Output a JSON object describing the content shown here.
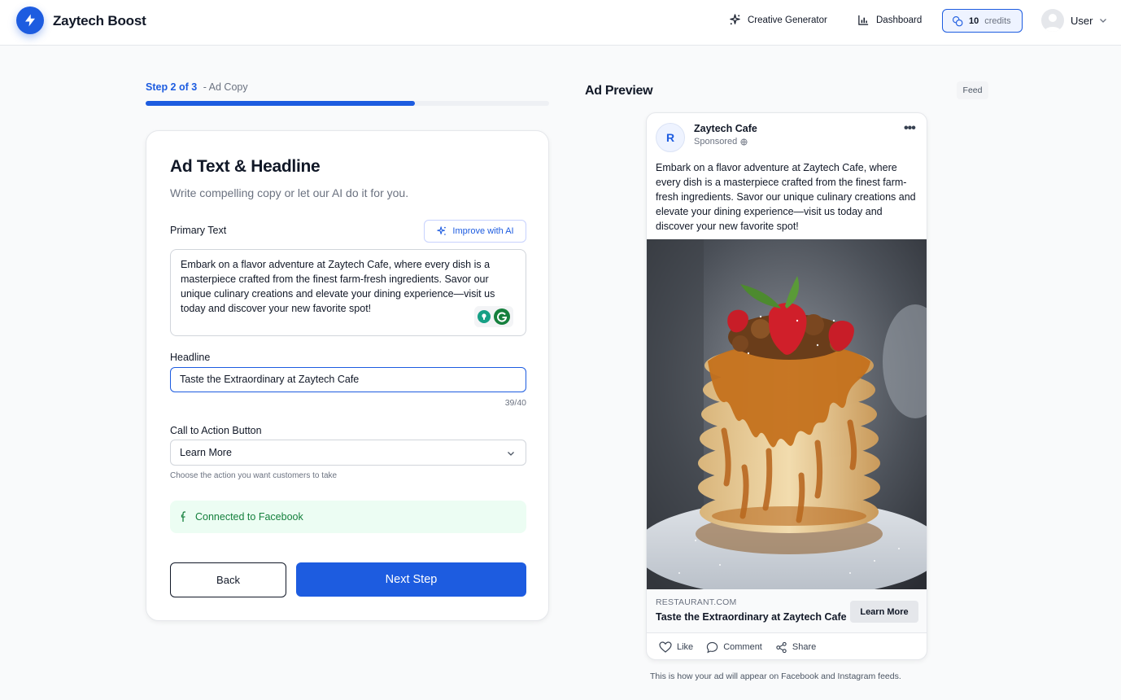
{
  "app": {
    "brand": "Zaytech Boost",
    "accent": "#1d5ce0"
  },
  "nav": {
    "creative": "Creative Generator",
    "dashboard": "Dashboard",
    "credits_count": "10",
    "credits_label": "credits",
    "user": "User"
  },
  "steps": {
    "current": "Step 2 of 3",
    "sub": "- Ad Copy",
    "progress": 0.667
  },
  "form": {
    "title": "Ad Text & Headline",
    "subtitle": "Write compelling copy or let our AI do it for you.",
    "primary_label": "Primary Text",
    "improve_label": "Improve with AI",
    "primary_value": "Embark on a flavor adventure at Zaytech Cafe, where every dish is a masterpiece crafted from the finest farm-fresh ingredients. Savor our unique culinary creations and elevate your dining experience—visit us today and discover your new favorite spot!",
    "headline_label": "Headline",
    "headline_value": "Taste the Extraordinary at Zaytech Cafe",
    "headline_counter": "39/40",
    "cta_label": "Call to Action Button",
    "cta_value": "Learn More",
    "cta_hint": "Choose the action you want customers to take",
    "connected": "Connected to Facebook",
    "back": "Back",
    "next": "Next Step"
  },
  "preview": {
    "title": "Ad Preview",
    "tag": "Feed",
    "page_initial": "R",
    "page_name": "Zaytech Cafe",
    "sponsored": "Sponsored",
    "menu": "•••",
    "text": "Embark on a flavor adventure at Zaytech Cafe, where every dish is a masterpiece crafted from the finest farm-fresh ingredients. Savor our unique culinary creations and elevate your dining experience—visit us today and discover your new favorite spot!",
    "domain": "RESTAURANT.COM",
    "headline": "Taste the Extraordinary at Zaytech Cafe",
    "cta": "Learn More",
    "like": "Like",
    "comment": "Comment",
    "share": "Share",
    "note": "This is how your ad will appear on Facebook and Instagram feeds."
  }
}
